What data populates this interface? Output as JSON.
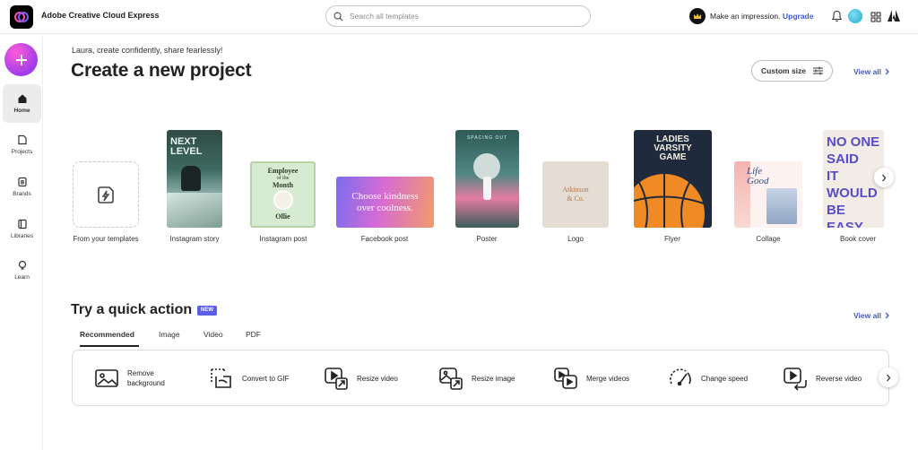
{
  "header": {
    "app_title": "Adobe Creative Cloud Express",
    "search_placeholder": "Search all templates",
    "impression_text": "Make an impression.",
    "upgrade_label": "Upgrade"
  },
  "sidebar": {
    "items": [
      {
        "label": "Home",
        "icon": "home-icon"
      },
      {
        "label": "Projects",
        "icon": "projects-icon"
      },
      {
        "label": "Brands",
        "icon": "brands-icon"
      },
      {
        "label": "Libraries",
        "icon": "libraries-icon"
      },
      {
        "label": "Learn",
        "icon": "learn-icon"
      }
    ]
  },
  "main": {
    "greeting": "Laura, create confidently, share fearlessly!",
    "title": "Create a new project",
    "custom_size_label": "Custom size",
    "view_all_label": "View all",
    "projects": [
      {
        "label": "From your templates"
      },
      {
        "label": "Instagram story",
        "art_text": [
          "NEXT",
          "LEVEL"
        ]
      },
      {
        "label": "Instagram post",
        "art_text": [
          "Employee",
          "of the",
          "Month",
          "Ollie"
        ]
      },
      {
        "label": "Facebook post",
        "art_text": [
          "Choose kindness",
          "over coolness."
        ]
      },
      {
        "label": "Poster",
        "art_text": "SPACING OUT"
      },
      {
        "label": "Logo",
        "art_text": [
          "Atkinson",
          "& Co."
        ]
      },
      {
        "label": "Flyer",
        "art_text": [
          "LADIES",
          "VARSITY",
          "GAME"
        ]
      },
      {
        "label": "Collage",
        "art_text": [
          "Life",
          "Good"
        ]
      },
      {
        "label": "Book cover",
        "art_text": [
          "NO ONE",
          "SAID",
          "IT",
          "WOULD",
          "BE EASY"
        ]
      }
    ]
  },
  "quick": {
    "title": "Try a quick action",
    "badge": "NEW",
    "view_all_label": "View all",
    "tabs": [
      "Recommended",
      "Image",
      "Video",
      "PDF"
    ],
    "actions": [
      {
        "label": "Remove background",
        "icon": "remove-background-icon"
      },
      {
        "label": "Convert to GIF",
        "icon": "convert-gif-icon"
      },
      {
        "label": "Resize video",
        "icon": "resize-video-icon"
      },
      {
        "label": "Resize image",
        "icon": "resize-image-icon"
      },
      {
        "label": "Merge videos",
        "icon": "merge-videos-icon"
      },
      {
        "label": "Change speed",
        "icon": "change-speed-icon"
      },
      {
        "label": "Reverse video",
        "icon": "reverse-video-icon"
      }
    ]
  },
  "colors": {
    "accent": "#3d5bd9",
    "new_badge": "#5b5fe6",
    "create_button": "#c445e8"
  }
}
